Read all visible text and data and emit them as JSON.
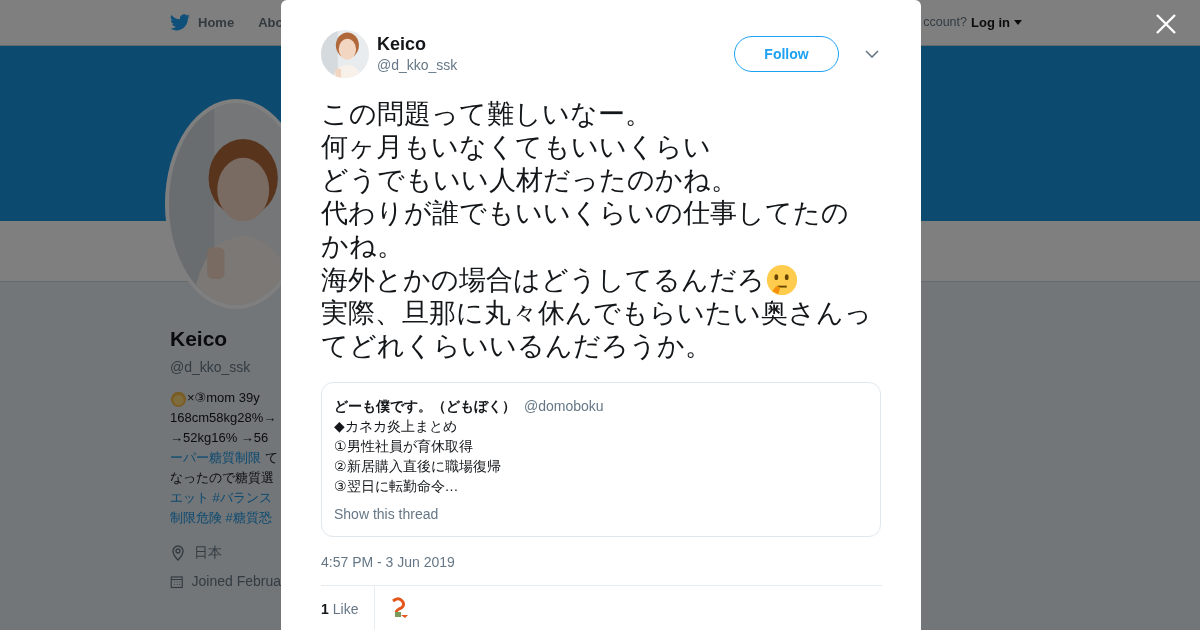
{
  "nav": {
    "items": [
      {
        "label": "Home"
      },
      {
        "label": "Abo"
      }
    ],
    "account_prompt": "ccount?",
    "login": "Log in"
  },
  "profile": {
    "name": "Keico",
    "handle": "@d_kko_ssk",
    "bio": [
      {
        "leading_icon": true,
        "segments": [
          {
            "text": "×③mom 39y",
            "link": false
          }
        ]
      },
      {
        "leading_icon": false,
        "segments": [
          {
            "text": "168cm58kg28%→",
            "link": false
          }
        ]
      },
      {
        "leading_icon": false,
        "segments": [
          {
            "text": "→52kg16% →56",
            "link": false
          }
        ]
      },
      {
        "leading_icon": false,
        "segments": [
          {
            "text": "ーパー糖質制限",
            "link": true
          },
          {
            "text": " て",
            "link": false
          }
        ]
      },
      {
        "leading_icon": false,
        "segments": [
          {
            "text": "なったので糖質選",
            "link": false
          }
        ]
      },
      {
        "leading_icon": false,
        "segments": [
          {
            "text": "エット #バランス",
            "link": true
          }
        ]
      },
      {
        "leading_icon": false,
        "segments": [
          {
            "text": "制限危険 #糖質恐",
            "link": true
          }
        ]
      }
    ],
    "location": "日本",
    "joined": "Joined Februa"
  },
  "tweet": {
    "author": {
      "name": "Keico",
      "handle": "@d_kko_ssk"
    },
    "follow": "Follow",
    "lines": [
      {
        "text": "この問題って難しいなー。",
        "trailing_icon": false
      },
      {
        "text": "何ヶ月もいなくてもいいくらい",
        "trailing_icon": false
      },
      {
        "text": "どうでもいい人材だったのかね。",
        "trailing_icon": false
      },
      {
        "text": "代わりが誰でもいいくらいの仕事してたの",
        "trailing_icon": false
      },
      {
        "text": "かね。",
        "trailing_icon": false
      },
      {
        "text": "海外とかの場合はどうしてるんだろ",
        "trailing_icon": true
      },
      {
        "text": "実際、旦那に丸々休んでもらいたい奥さんっ",
        "trailing_icon": false
      },
      {
        "text": "てどれくらいいるんだろうか。",
        "trailing_icon": false
      }
    ],
    "quote": {
      "name": "どーも僕です。（どもぼく）",
      "handle": "@domoboku",
      "lines": [
        "◆カネカ炎上まとめ",
        "①男性社員が育休取得",
        "②新居購入直後に職場復帰",
        "③翌日に転勤命令…"
      ],
      "thread_link": "Show this thread"
    },
    "timestamp": "4:57 PM - 3 Jun 2019",
    "likes": {
      "count": "1",
      "label": "Like"
    }
  }
}
